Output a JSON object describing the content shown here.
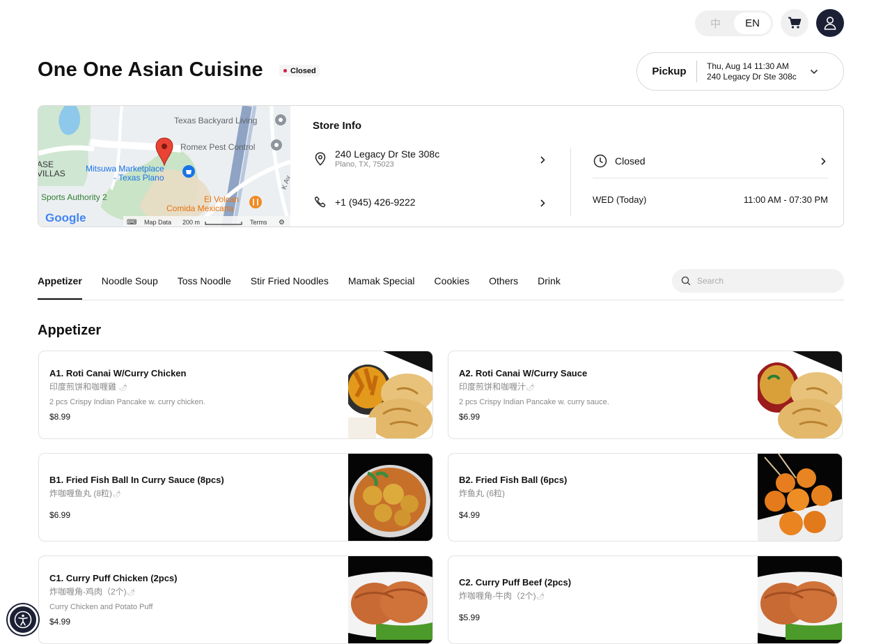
{
  "header": {
    "lang_zh": "中",
    "lang_en": "EN",
    "active_lang": "EN"
  },
  "store": {
    "name": "One One Asian Cuisine",
    "status": "Closed"
  },
  "pickup": {
    "label": "Pickup",
    "datetime": "Thu, Aug 14 11:30 AM",
    "address": "240 Legacy Dr Ste 308c"
  },
  "map": {
    "labels": [
      "Texas Backyard Living",
      "Romex Pest Control",
      "ASE",
      "VILLAS",
      "Mitsuwa Marketplace",
      "- Texas Plano",
      "Sports Authority 2",
      "El Volcan",
      "Comida Mexicana",
      "K Av"
    ],
    "google": "Google",
    "map_data": "Map Data",
    "scale": "200 m",
    "terms": "Terms"
  },
  "store_info": {
    "title": "Store Info",
    "address_line1": "240 Legacy Dr Ste 308c",
    "address_line2": "Plano, TX, 75023",
    "phone": "+1 (945) 426-9222",
    "status": "Closed",
    "day": "WED (Today)",
    "hours": "11:00 AM - 07:30 PM"
  },
  "tabs": [
    "Appetizer",
    "Noodle Soup",
    "Toss Noodle",
    "Stir Fried Noodles",
    "Mamak Special",
    "Cookies",
    "Others",
    "Drink"
  ],
  "active_tab": "Appetizer",
  "search": {
    "placeholder": "Search"
  },
  "section": {
    "title": "Appetizer"
  },
  "items": [
    {
      "name": "A1. Roti Canai W/Curry Chicken",
      "cn": "印度煎饼和咖喱雞",
      "desc": "2 pcs Crispy Indian Pancake w. curry chicken.",
      "price": "$8.99",
      "image": "roti-curry-chicken"
    },
    {
      "name": "A2. Roti Canai W/Curry Sauce",
      "cn": "印度煎饼和咖喱汁",
      "desc": "2 pcs Crispy Indian Pancake w. curry sauce.",
      "price": "$6.99",
      "image": "roti-curry-sauce"
    },
    {
      "name": "B1. Fried Fish Ball In Curry Sauce (8pcs)",
      "cn": "炸咖喱鱼丸 (8粒)",
      "desc": "",
      "price": "$6.99",
      "image": "fish-ball-curry"
    },
    {
      "name": "B2. Fried Fish Ball (6pcs)",
      "cn": "炸鱼丸 (6粒)",
      "desc": "",
      "price": "$4.99",
      "image": "fried-fish-ball"
    },
    {
      "name": "C1. Curry Puff Chicken (2pcs)",
      "cn": "炸咖喱角-鸡肉（2个)",
      "desc": "Curry Chicken and Potato Puff",
      "price": "$4.99",
      "image": "curry-puff"
    },
    {
      "name": "C2. Curry Puff Beef (2pcs)",
      "cn": "炸咖喱角-牛肉（2个)",
      "desc": "",
      "price": "$5.99",
      "image": "curry-puff"
    }
  ],
  "colors": {
    "dark": "#1b2035",
    "status_dot": "#d01c4b",
    "border": "#d9d9d9"
  }
}
